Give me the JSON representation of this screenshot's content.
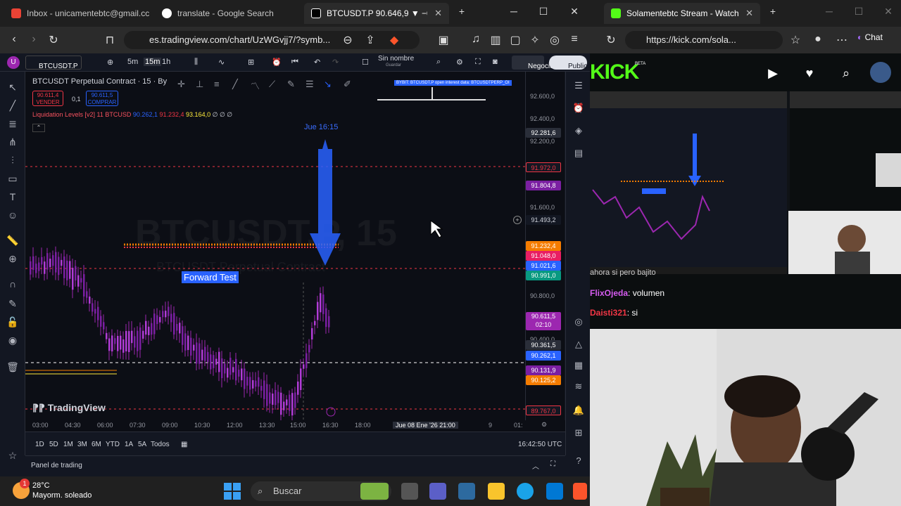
{
  "left_browser": {
    "tabs": [
      {
        "label": "Inbox - unicamentebtc@gmail.cc"
      },
      {
        "label": "translate - Google Search"
      },
      {
        "label": "BTCUSDT.P 90.646,9 ▼ −0.75"
      }
    ],
    "url": "es.tradingview.com/chart/UzWGvjj7/?symb...",
    "tv_toolbar": {
      "symbol": "BTCUSDT.P",
      "intervals": [
        "5m",
        "15m",
        "1h"
      ],
      "layout_name": "Sin nombre",
      "layout_sub": "Guardar",
      "negocie": "Negocie",
      "publicar": "Publicar"
    },
    "chart": {
      "legend_title": "BTCUSDT Perpetual Contract · 15 · By",
      "sell_price": "90.611,4",
      "sell_label": "VENDER",
      "spread": "0,1",
      "buy_price": "90.611,5",
      "buy_label": "COMPRAR",
      "indicator": "Liquidation Levels [v2] 11 BTCUSD",
      "indicator_v1": "90.262,1",
      "indicator_v2": "91.232,4",
      "indicator_v3": "93.164,0",
      "indicator_tail": "∅ ∅ ∅",
      "watermark": "BTCUSDT.P, 15",
      "watermark_sub": "BTCUSDT Perpetual Contract",
      "date_label": "Jue 16:15",
      "forward_test": "Forward Test",
      "bybit_label": "BYBIT: BTCUSDT.P open interest data: BTCUSDTPERP_OI",
      "tv_logo": "TradingView",
      "price_labels": [
        "92.600,0",
        "92.400,0",
        "92.200,0",
        "91.600,0",
        "90.800,0",
        "90.400,0"
      ],
      "price_badges": [
        {
          "text": "92.281,6",
          "color": "#2a2e39"
        },
        {
          "text": "91.972,0",
          "color": "#131722"
        },
        {
          "text": "91.804,8",
          "color": "#7b1fa2"
        },
        {
          "text": "91.493,2",
          "color": "#131722"
        },
        {
          "text": "91.232,4",
          "color": "#f57c00"
        },
        {
          "text": "91.048,0",
          "color": "#e91e63"
        },
        {
          "text": "91.021,6",
          "color": "#2962ff"
        },
        {
          "text": "90.991,0",
          "color": "#089981"
        },
        {
          "text": "90.611,5\n02:10",
          "color": "#9c27b0"
        },
        {
          "text": "90.361,5",
          "color": "#2a2e39"
        },
        {
          "text": "90.262,1",
          "color": "#2962ff"
        },
        {
          "text": "90.131,9",
          "color": "#7b1fa2"
        },
        {
          "text": "90.125,2",
          "color": "#f57c00"
        },
        {
          "text": "89.767,0",
          "color": "#131722"
        }
      ],
      "time_labels": [
        "03:00",
        "04:30",
        "06:00",
        "07:30",
        "09:00",
        "10:30",
        "12:00",
        "13:30",
        "15:00",
        "16:30",
        "18:00",
        "9",
        "01:"
      ],
      "time_cursor": "Jue 08 Ene '26   21:00",
      "ranges": [
        "1D",
        "5D",
        "1M",
        "3M",
        "6M",
        "YTD",
        "1A",
        "5A",
        "Todos"
      ],
      "clock": "16:42:50 UTC",
      "panel_label": "Panel de trading"
    }
  },
  "right_browser": {
    "tab_label": "Solamentebtc Stream - Watch Live",
    "url": "https://kick.com/sola...",
    "chat_button": "Chat",
    "kick_logo": "KICK",
    "kick_beta": "BETA",
    "chat": [
      {
        "user": "",
        "text": "ahora si pero bajito"
      },
      {
        "user": "FlixOjeda",
        "text": ": volumen"
      },
      {
        "user": "Daisti321",
        "text": ": si"
      }
    ]
  },
  "taskbar": {
    "temperature": "28°C",
    "weather": "Mayorm. soleado",
    "search_placeholder": "Buscar",
    "badge": "1"
  }
}
